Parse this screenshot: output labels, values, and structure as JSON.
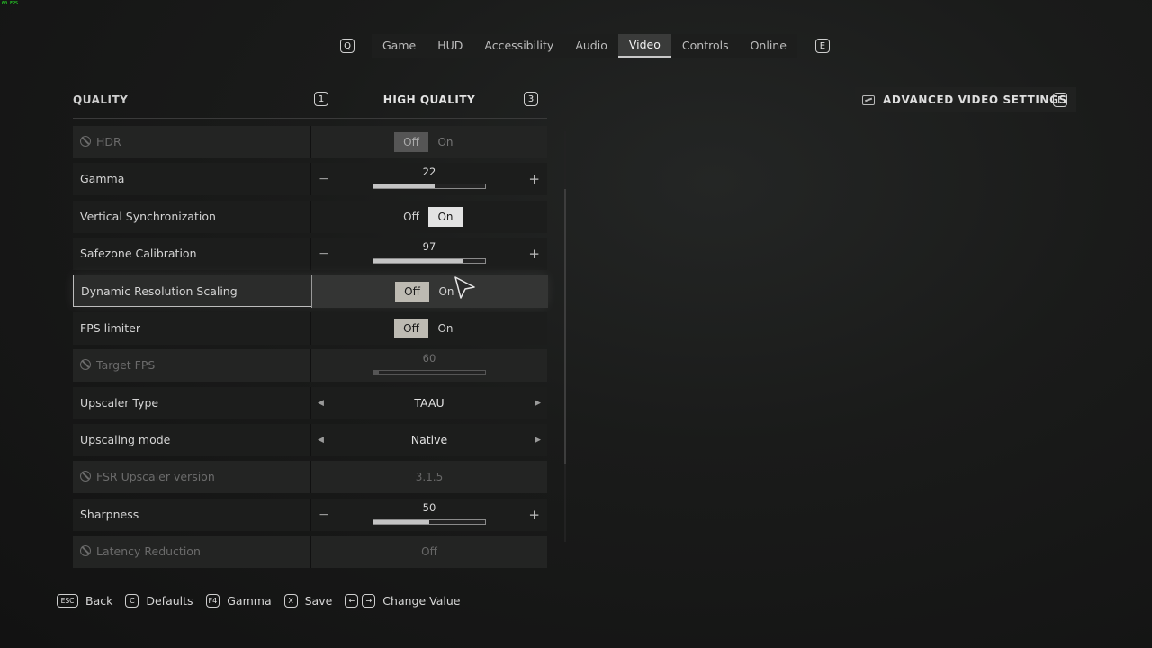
{
  "overlay": {
    "fps": "60 FPS"
  },
  "tabs": {
    "prev_key": "Q",
    "next_key": "E",
    "items": [
      "Game",
      "HUD",
      "Accessibility",
      "Audio",
      "Video",
      "Controls",
      "Online"
    ],
    "active": "Video"
  },
  "quality": {
    "label": "QUALITY",
    "prev_key": "1",
    "value": "HIGH QUALITY",
    "next_key": "3"
  },
  "advanced": {
    "label": "ADVANCED VIDEO SETTINGS",
    "key": "F"
  },
  "settings": [
    {
      "label": "HDR",
      "type": "toggle",
      "off": "Off",
      "on": "On",
      "selected": "Off",
      "disabled": true
    },
    {
      "label": "Gamma",
      "type": "slider",
      "value": "22",
      "fraction": 0.55
    },
    {
      "label": "Vertical Synchronization",
      "type": "toggle",
      "off": "Off",
      "on": "On",
      "selected": "On"
    },
    {
      "label": "Safezone Calibration",
      "type": "slider",
      "value": "97",
      "fraction": 0.81
    },
    {
      "label": "Dynamic Resolution Scaling",
      "type": "toggle",
      "off": "Off",
      "on": "On",
      "selected": "Off",
      "focused": true
    },
    {
      "label": "FPS limiter",
      "type": "toggle",
      "off": "Off",
      "on": "On",
      "selected": "Off"
    },
    {
      "label": "Target FPS",
      "type": "slider",
      "value": "60",
      "fraction": 0.05,
      "disabled": true
    },
    {
      "label": "Upscaler Type",
      "type": "select",
      "value": "TAAU"
    },
    {
      "label": "Upscaling mode",
      "type": "select",
      "value": "Native"
    },
    {
      "label": "FSR Upscaler version",
      "type": "readonly",
      "value": "3.1.5",
      "disabled": true
    },
    {
      "label": "Sharpness",
      "type": "slider",
      "value": "50",
      "fraction": 0.5
    },
    {
      "label": "Latency Reduction",
      "type": "readonly",
      "value": "Off",
      "disabled": true
    }
  ],
  "footer": [
    {
      "key": "ESC",
      "label": "Back"
    },
    {
      "key": "C",
      "label": "Defaults"
    },
    {
      "key": "F4",
      "label": "Gamma"
    },
    {
      "key": "X",
      "label": "Save"
    },
    {
      "key": "←",
      "key2": "→",
      "label": "Change Value"
    }
  ],
  "colors": {
    "background": "#141414",
    "row": "#1c1d1c",
    "highlight": "#e2e2e2",
    "accent": "#bdbab2"
  }
}
